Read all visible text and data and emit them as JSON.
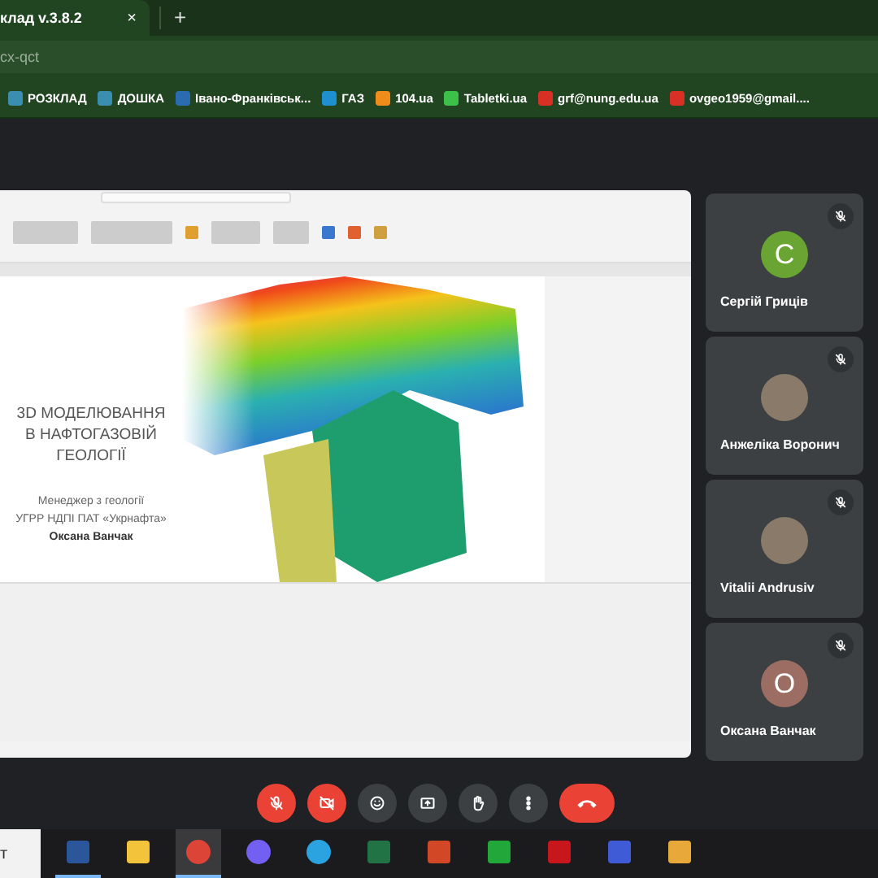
{
  "browser": {
    "tab": {
      "title": "клад v.3.8.2",
      "close": "×",
      "selected": true
    },
    "new_tab": "+",
    "address": "cx-qct",
    "bookmarks": [
      {
        "label": "РОЗКЛАД",
        "color": "#3a8fb0"
      },
      {
        "label": "ДОШКА",
        "color": "#3a8fb0"
      },
      {
        "label": "Івано-Франківськ...",
        "color": "#2b6cb0"
      },
      {
        "label": "ГАЗ",
        "color": "#1e90d0"
      },
      {
        "label": "104.ua",
        "color": "#f08c1a"
      },
      {
        "label": "Tabletki.ua",
        "color": "#3cc04a"
      },
      {
        "label": "grf@nung.edu.ua",
        "color": "#d93025"
      },
      {
        "label": "ovgeo1959@gmail....",
        "color": "#d93025"
      }
    ]
  },
  "presentation": {
    "slide": {
      "title_lines": [
        "3D МОДЕЛЮВАННЯ",
        "В НАФТОГАЗОВІЙ",
        "ГЕОЛОГІЇ"
      ],
      "role": "Менеджер з геології",
      "org": "УГРР НДПІ ПАТ «Укрнафта»",
      "author": "Оксана Ванчак"
    }
  },
  "participants": [
    {
      "name": "Сергій Гриців",
      "kind": "letter",
      "letter": "С",
      "color": "#6aa533",
      "muted": true
    },
    {
      "name": "Анжеліка Воронич",
      "kind": "photo",
      "muted": true
    },
    {
      "name": "Vitalii Andrusiv",
      "kind": "photo",
      "muted": true
    },
    {
      "name": "Оксана Ванчак",
      "kind": "letter",
      "letter": "О",
      "color": "#9c6e63",
      "muted": true
    }
  ],
  "controls": [
    {
      "kind": "mic",
      "on": false
    },
    {
      "kind": "camera",
      "on": false
    },
    {
      "kind": "emoji"
    },
    {
      "kind": "present"
    },
    {
      "kind": "hand"
    },
    {
      "kind": "more"
    },
    {
      "kind": "hangup"
    }
  ],
  "taskbar": {
    "search": "т",
    "apps": [
      {
        "kind": "word",
        "selected": false,
        "running": true
      },
      {
        "kind": "folder",
        "selected": false,
        "running": false
      },
      {
        "kind": "chrome",
        "selected": true,
        "running": true
      },
      {
        "kind": "viber",
        "selected": false,
        "running": false
      },
      {
        "kind": "telegram",
        "selected": false,
        "running": false
      },
      {
        "kind": "excel",
        "selected": false,
        "running": false
      },
      {
        "kind": "powerpoint",
        "selected": false,
        "running": false
      },
      {
        "kind": "pen",
        "selected": false,
        "running": false
      },
      {
        "kind": "reader",
        "selected": false,
        "running": false
      },
      {
        "kind": "save",
        "selected": false,
        "running": false
      },
      {
        "kind": "image",
        "selected": false,
        "running": false
      }
    ]
  }
}
